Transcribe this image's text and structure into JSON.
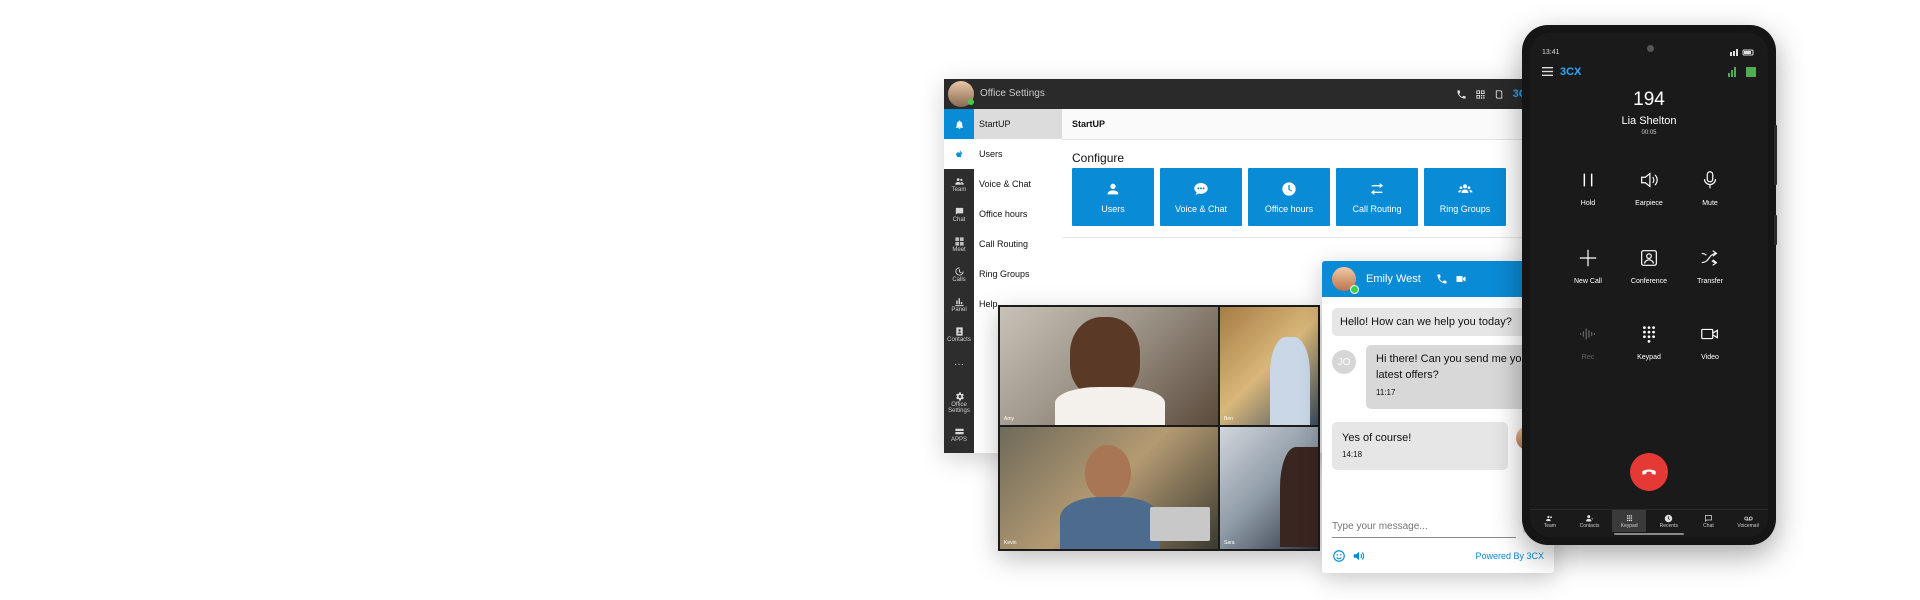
{
  "desktop": {
    "window_title": "Office Settings",
    "brand": "3CX",
    "rail": [
      {
        "label": "",
        "icon": "bell-icon"
      },
      {
        "label": "",
        "icon": "apple-icon"
      },
      {
        "label": "Team",
        "icon": "team-icon"
      },
      {
        "label": "Chat",
        "icon": "chat-icon"
      },
      {
        "label": "Meet",
        "icon": "meet-icon"
      },
      {
        "label": "Calls",
        "icon": "calls-icon"
      },
      {
        "label": "Panel",
        "icon": "panel-icon"
      },
      {
        "label": "Contacts",
        "icon": "contacts-icon"
      },
      {
        "label": "···",
        "icon": "more-icon"
      },
      {
        "label": "Office Settings",
        "icon": "gear-icon"
      },
      {
        "label": "APPS",
        "icon": "apps-icon"
      }
    ],
    "menu": [
      "StartUP",
      "Users",
      "Voice & Chat",
      "Office hours",
      "Call Routing",
      "Ring Groups",
      "Help"
    ],
    "main_title": "StartUP",
    "configure_label": "Configure",
    "tiles": [
      "Users",
      "Voice & Chat",
      "Office hours",
      "Call Routing",
      "Ring Groups"
    ],
    "accent": "#0a8bd6"
  },
  "video": {
    "participants": [
      "Amy",
      "Ben",
      "Kevin",
      "Sara"
    ]
  },
  "chat": {
    "agent_name": "Emily West",
    "messages": [
      {
        "from": "agent",
        "text": "Hello! How can we help you today?"
      },
      {
        "from": "visitor",
        "initials": "JO",
        "text": "Hi there! Can you send me your latest offers?",
        "time": "11:17"
      },
      {
        "from": "agent",
        "text": "Yes of course!",
        "time": "14:18"
      }
    ],
    "input_placeholder": "Type your message...",
    "powered_by": "Powered By 3CX"
  },
  "phone": {
    "status_time": "13:41",
    "brand": "3CX",
    "number": "194",
    "name": "Lia Shelton",
    "timer": "00:05",
    "buttons": [
      "Hold",
      "Earpiece",
      "Mute",
      "New Call",
      "Conference",
      "Transfer",
      "Rec",
      "Keypad",
      "Video"
    ],
    "nav": [
      "Team",
      "Contacts",
      "Keypad",
      "Recents",
      "Chat",
      "Voicemail"
    ],
    "hangup_color": "#e53935"
  }
}
